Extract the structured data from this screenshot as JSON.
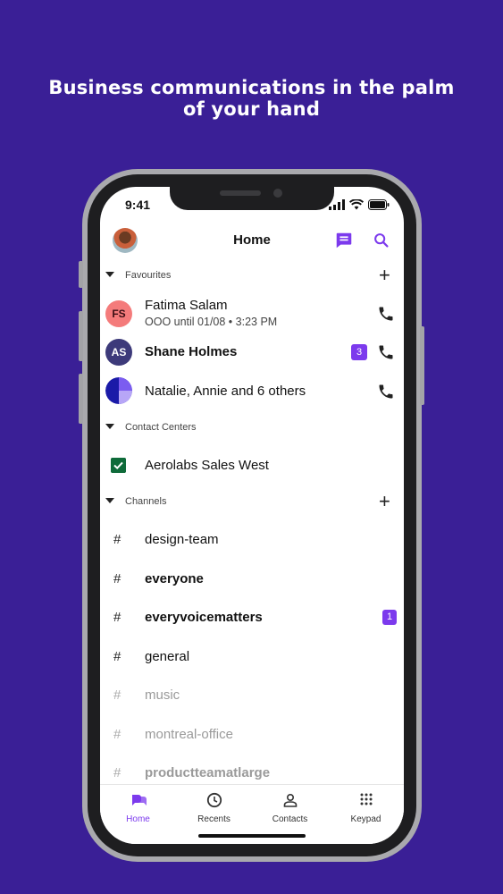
{
  "headline": "Business communications in the palm of your hand",
  "status_bar": {
    "time": "9:41"
  },
  "header": {
    "title": "Home"
  },
  "favourites": {
    "label": "Favourites",
    "items": [
      {
        "initials": "FS",
        "name": "Fatima Salam",
        "status": "OOO until 01/08 • 3:23 PM"
      },
      {
        "initials": "AS",
        "name": "Shane Holmes",
        "badge": "3"
      },
      {
        "name": "Natalie, Annie and 6 others"
      }
    ]
  },
  "contact_centers": {
    "label": "Contact Centers",
    "items": [
      {
        "name": "Aerolabs Sales West"
      }
    ]
  },
  "channels": {
    "label": "Channels",
    "items": [
      {
        "hash": "#",
        "name": "design-team"
      },
      {
        "hash": "#",
        "name": "everyone"
      },
      {
        "hash": "#",
        "name": "everyvoicematters",
        "badge": "1"
      },
      {
        "hash": "#",
        "name": "general"
      },
      {
        "hash": "#",
        "name": "music"
      },
      {
        "hash": "#",
        "name": "montreal-office"
      },
      {
        "hash": "#",
        "name": "productteamatlarge"
      }
    ]
  },
  "bottom_nav": [
    {
      "label": "Home",
      "icon": "home-chat-icon"
    },
    {
      "label": "Recents",
      "icon": "clock-icon"
    },
    {
      "label": "Contacts",
      "icon": "person-icon"
    },
    {
      "label": "Keypad",
      "icon": "keypad-icon"
    }
  ],
  "colors": {
    "background": "#3a1f96",
    "accent": "#7c3aed",
    "fs_avatar": "#f47b7b",
    "as_avatar": "#3d3a7a",
    "checkbox": "#0f6b3a"
  }
}
